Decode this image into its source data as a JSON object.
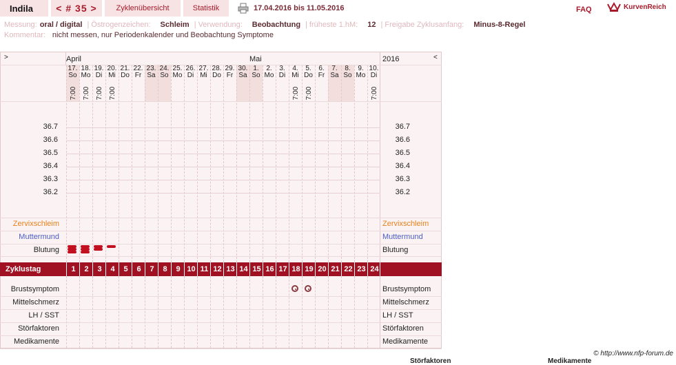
{
  "header": {
    "name": "Indila",
    "cycle": "< # 35 >",
    "tabs": [
      "Zyklenübersicht",
      "Statistik"
    ],
    "date_range": "17.04.2016 bis 11.05.2016",
    "faq": "FAQ",
    "logo_text": "KurvenReich"
  },
  "info": {
    "messung_label": "Messung:",
    "messung_value": "oral / digital",
    "oestrogen_label": "Östrogenzeichen:",
    "oestrogen_value": "Schleim",
    "verwendung_label": "Verwendung:",
    "verwendung_value": "Beobachtung",
    "fruehe_label": "früheste 1.hM:",
    "fruehe_value": "12",
    "freigabe_label": "Freigabe Zyklusanfang:",
    "freigabe_value": "Minus-8-Regel",
    "kommentar_label": "Kommentar:",
    "kommentar_value": "nicht messen, nur Periodenkalender und Beobachtung Symptome"
  },
  "chart": {
    "nav_left": ">",
    "nav_right": "<",
    "month_april": "April",
    "month_mai": "Mai",
    "year": "2016",
    "days": [
      {
        "d": "17.",
        "w": "So",
        "t": "7:00",
        "we": true
      },
      {
        "d": "18.",
        "w": "Mo",
        "t": "7:00",
        "we": false
      },
      {
        "d": "19.",
        "w": "Di",
        "t": "7:00",
        "we": false
      },
      {
        "d": "20.",
        "w": "Mi",
        "t": "7:00",
        "we": false
      },
      {
        "d": "21.",
        "w": "Do",
        "t": "",
        "we": false
      },
      {
        "d": "22.",
        "w": "Fr",
        "t": "",
        "we": false
      },
      {
        "d": "23.",
        "w": "Sa",
        "t": "",
        "we": true
      },
      {
        "d": "24.",
        "w": "So",
        "t": "",
        "we": true
      },
      {
        "d": "25.",
        "w": "Mo",
        "t": "",
        "we": false
      },
      {
        "d": "26.",
        "w": "Di",
        "t": "",
        "we": false
      },
      {
        "d": "27.",
        "w": "Mi",
        "t": "",
        "we": false
      },
      {
        "d": "28.",
        "w": "Do",
        "t": "",
        "we": false
      },
      {
        "d": "29.",
        "w": "Fr",
        "t": "",
        "we": false
      },
      {
        "d": "30.",
        "w": "Sa",
        "t": "",
        "we": true
      },
      {
        "d": "1.",
        "w": "So",
        "t": "",
        "we": true
      },
      {
        "d": "2.",
        "w": "Mo",
        "t": "",
        "we": false
      },
      {
        "d": "3.",
        "w": "Di",
        "t": "",
        "we": false
      },
      {
        "d": "4.",
        "w": "Mi",
        "t": "7:00",
        "we": false
      },
      {
        "d": "5.",
        "w": "Do",
        "t": "7:00",
        "we": false
      },
      {
        "d": "6.",
        "w": "Fr",
        "t": "",
        "we": false
      },
      {
        "d": "7.",
        "w": "Sa",
        "t": "",
        "we": true
      },
      {
        "d": "8.",
        "w": "So",
        "t": "",
        "we": true
      },
      {
        "d": "9.",
        "w": "Mo",
        "t": "",
        "we": false
      },
      {
        "d": "10.",
        "w": "Di",
        "t": "7:00",
        "we": false
      }
    ],
    "temps": [
      "36.7",
      "36.6",
      "36.5",
      "36.4",
      "36.3",
      "36.2"
    ],
    "rows_top": [
      "Zervixschleim",
      "Muttermund",
      "Blutung"
    ],
    "zyklustag_label": "Zyklustag",
    "zyklustage": [
      "1",
      "2",
      "3",
      "4",
      "5",
      "6",
      "7",
      "8",
      "9",
      "10",
      "11",
      "12",
      "13",
      "14",
      "15",
      "16",
      "17",
      "18",
      "19",
      "20",
      "21",
      "22",
      "23",
      "24"
    ],
    "rows_bottom": [
      "Brustsymptom",
      "Mittelschmerz",
      "LH / SST",
      "Störfaktoren",
      "Medikamente"
    ],
    "blutung": [
      3,
      3,
      2,
      1
    ],
    "brust_days": [
      18,
      19
    ],
    "colors": {
      "zervix": "#e8801a",
      "mutter": "#4a5cc8",
      "accent": "#a01222"
    }
  },
  "footer": {
    "copyright": "© http://www.nfp-forum.de",
    "cut1": "Störfaktoren",
    "cut2": "Medikamente"
  }
}
